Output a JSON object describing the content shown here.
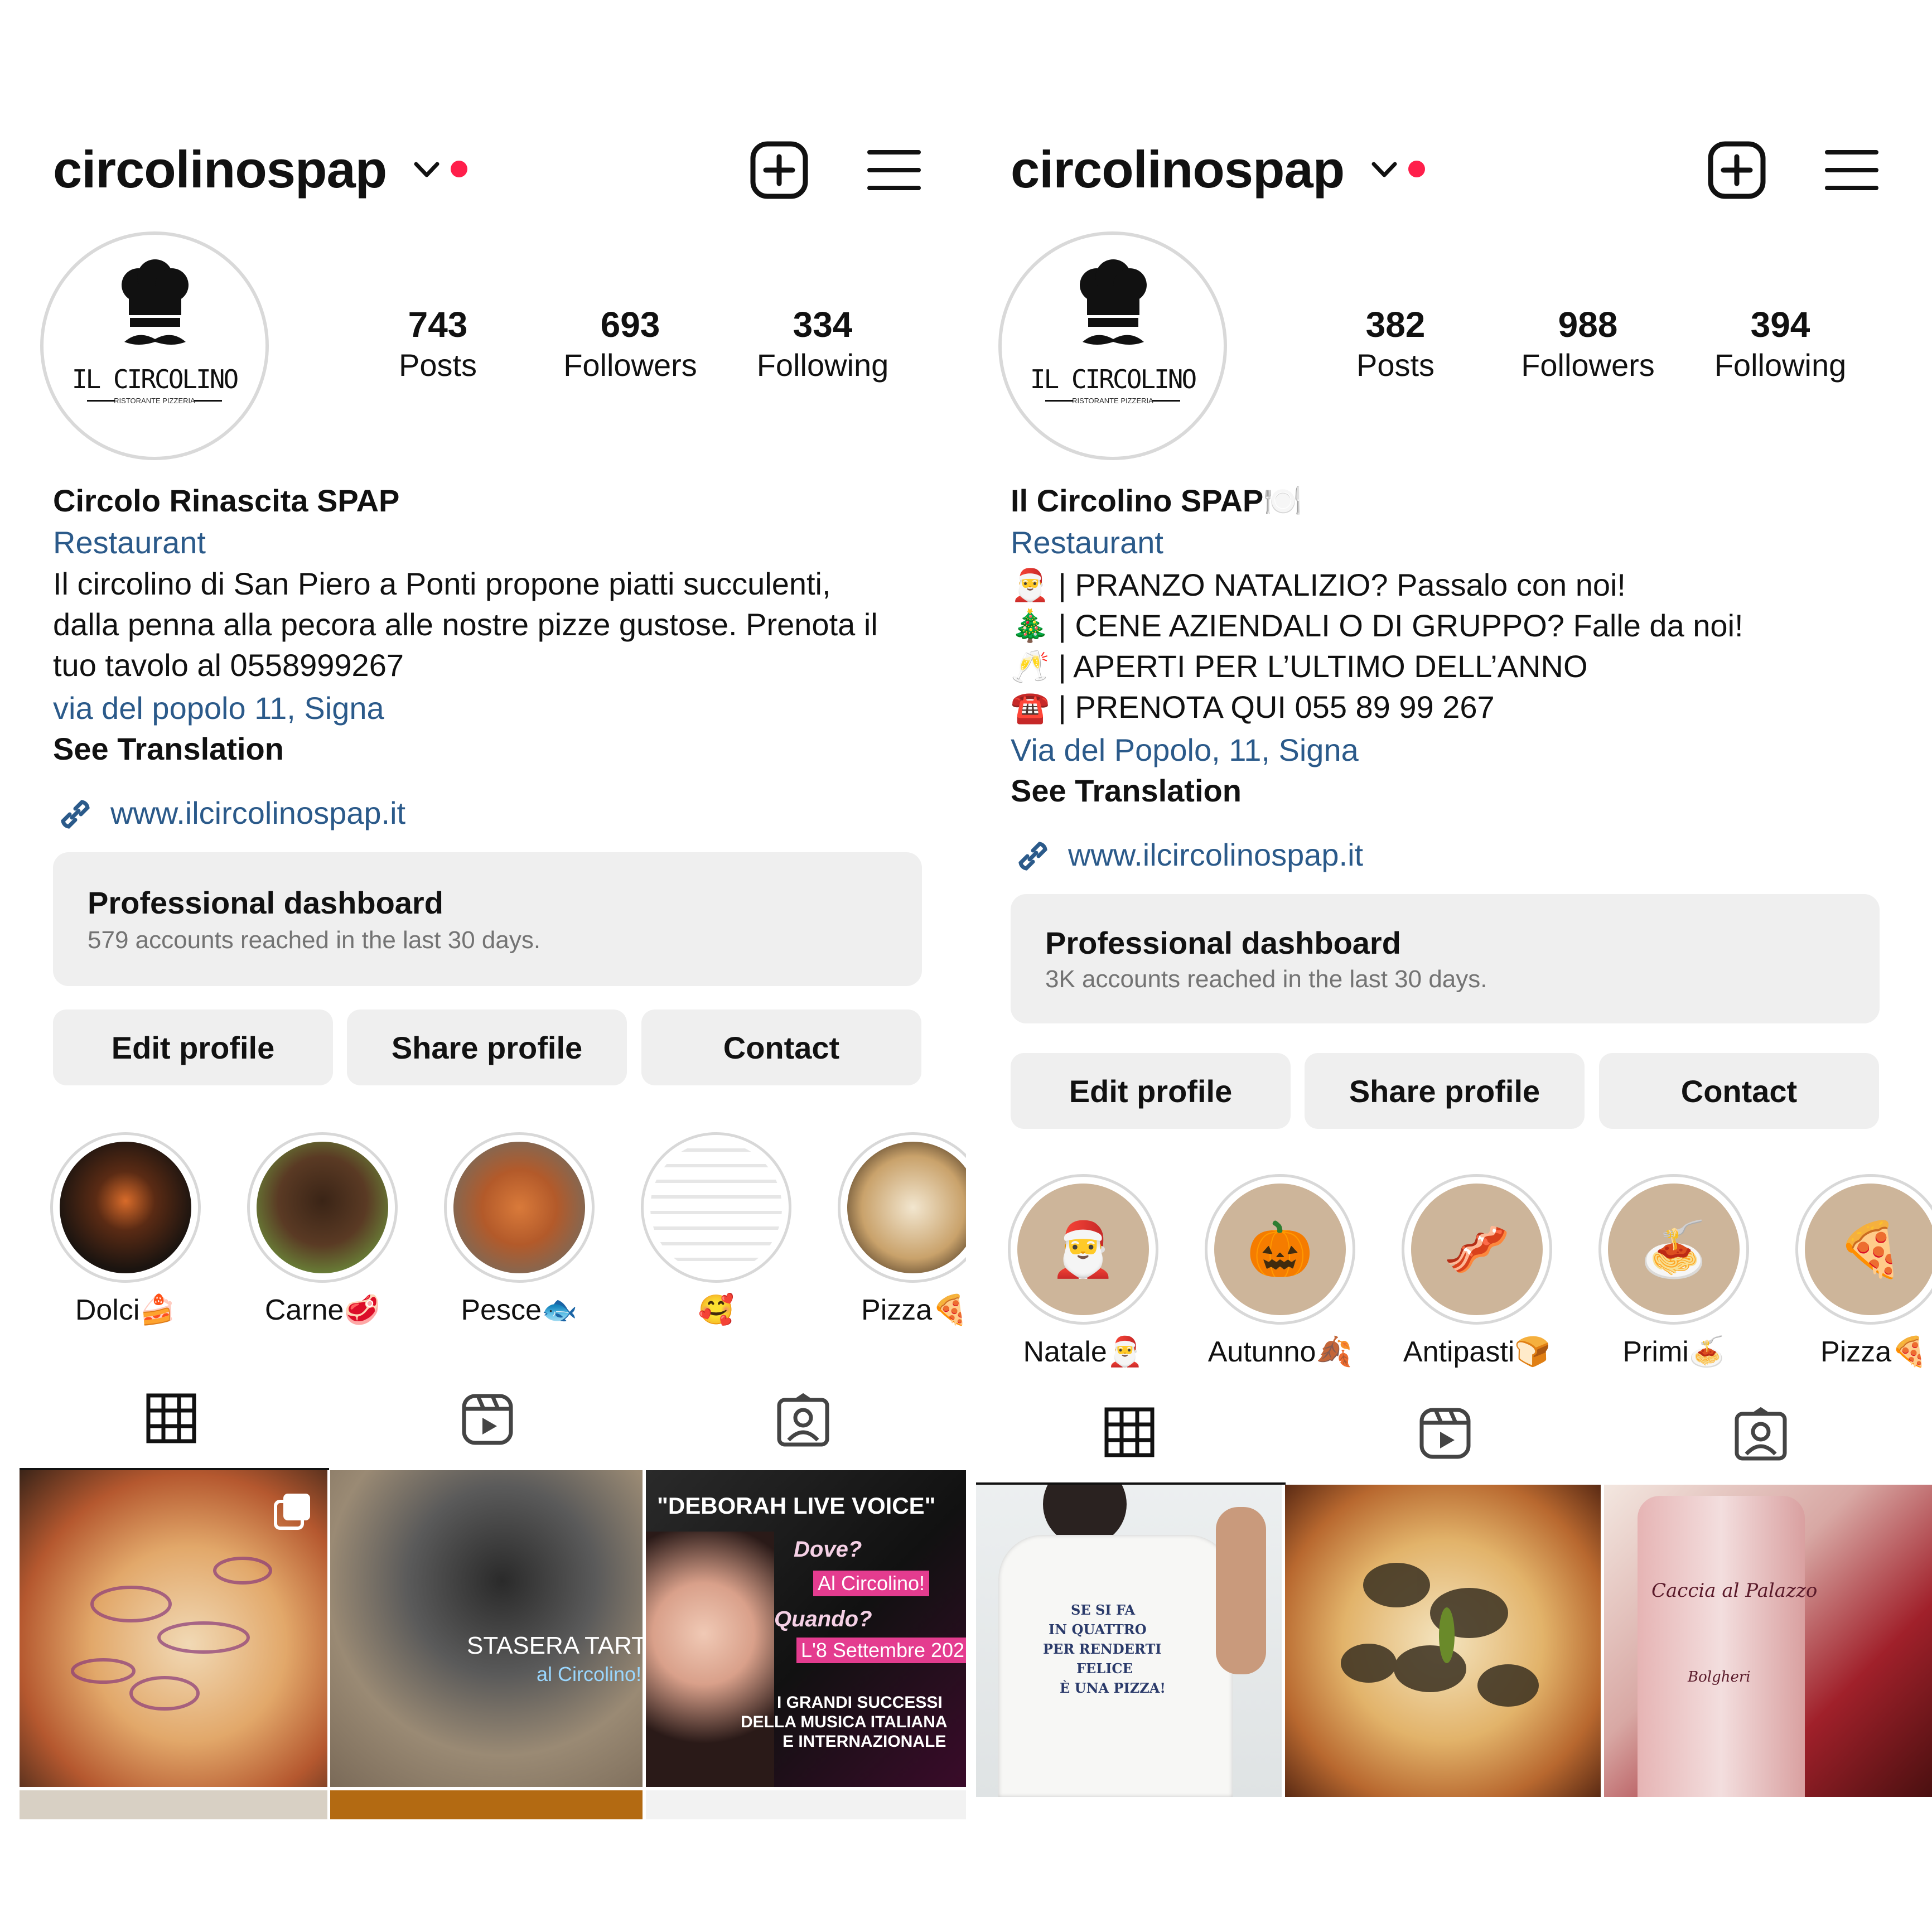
{
  "left": {
    "username": "circolinospap",
    "avatar_logo": "IL CIRCOLINO",
    "avatar_sub": "RISTORANTE PIZZERIA",
    "stats": [
      {
        "value": "743",
        "label": "Posts"
      },
      {
        "value": "693",
        "label": "Followers"
      },
      {
        "value": "334",
        "label": "Following"
      }
    ],
    "name": "Circolo Rinascita SPAP",
    "category": "Restaurant",
    "bio_lines": [
      "Il circolino di San Piero a Ponti propone piatti succulenti,",
      "dalla penna alla pecora alle nostre pizze gustose. Prenota il",
      "tuo tavolo al 0558999267"
    ],
    "address": "via del popolo 11, Signa",
    "see_translation": "See Translation",
    "website": "www.ilcircolinospap.it",
    "dashboard": {
      "title": "Professional dashboard",
      "subtitle": "579 accounts reached in the last 30 days."
    },
    "buttons": [
      "Edit profile",
      "Share profile",
      "Contact"
    ],
    "highlights": [
      "Dolci🍰",
      "Carne🥩",
      "Pesce🐟",
      "🥰",
      "Pizza🍕"
    ],
    "posts": [
      {
        "text": ""
      },
      {
        "text": "STASERA TARTUFO",
        "sub": "al Circolino!"
      },
      {
        "text": "\"DEBORAH LIVE VOICE\"",
        "l1": "Dove?",
        "l2": "Al Circolino!",
        "l3": "Quando?",
        "l4": "L'8 Settembre 202",
        "l5": "I GRANDI SUCCESSI",
        "l6": "DELLA MUSICA ITALIANA",
        "l7": "E INTERNAZIONALE"
      }
    ]
  },
  "right": {
    "username": "circolinospap",
    "avatar_logo": "IL CIRCOLINO",
    "avatar_sub": "RISTORANTE PIZZERIA",
    "stats": [
      {
        "value": "382",
        "label": "Posts"
      },
      {
        "value": "988",
        "label": "Followers"
      },
      {
        "value": "394",
        "label": "Following"
      }
    ],
    "name": "Il Circolino SPAP🍽️",
    "category": "Restaurant",
    "bio_lines": [
      "🎅 | PRANZO NATALIZIO? Passalo con noi!",
      "🎄 | CENE AZIENDALI O DI GRUPPO? Falle da noi!",
      "🥂 | APERTI PER L’ULTIMO DELL’ANNO",
      "☎️ | PRENOTA QUI 055 89 99 267"
    ],
    "address": "Via del Popolo, 11, Signa",
    "see_translation": "See Translation",
    "website": "www.ilcircolinospap.it",
    "dashboard": {
      "title": "Professional dashboard",
      "subtitle": "3K accounts reached in the last 30 days."
    },
    "buttons": [
      "Edit profile",
      "Share profile",
      "Contact"
    ],
    "highlights": [
      "Natale🎅",
      "Autunno🍂",
      "Antipasti🍞",
      "Primi🍝",
      "Pizza🍕"
    ],
    "highlight_icons": [
      "🎅",
      "🎃",
      "🥓",
      "🍝",
      "🍕"
    ],
    "posts": [
      {
        "l1": "SE SI FA",
        "l2": "IN QUATTRO",
        "l3": "PER RENDERTI",
        "l4": "FELICE",
        "l5": "È UNA PIZZA!"
      },
      {
        "text": ""
      },
      {
        "l1": "Caccia al Palazzo",
        "l2": "Bolgheri"
      }
    ]
  },
  "colors": {
    "accent_link": "#2b5a8a",
    "notification_dot": "#ff1f4b",
    "button_bg": "#efefef",
    "muted_text": "#737373"
  },
  "icons": [
    "chevron-down-icon",
    "new-post-icon",
    "menu-icon",
    "link-icon",
    "grid-icon",
    "reels-icon",
    "tagged-icon",
    "carousel-icon"
  ]
}
